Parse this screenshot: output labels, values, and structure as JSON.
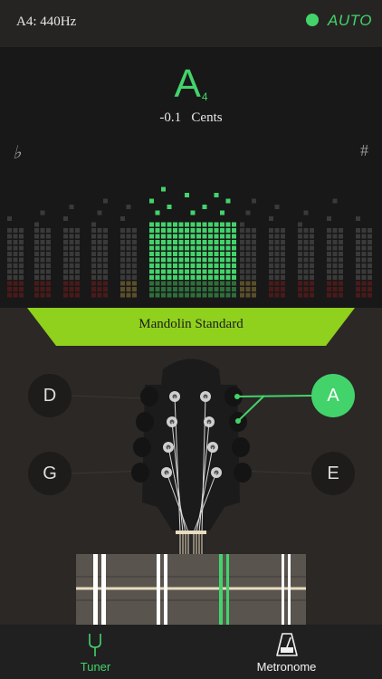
{
  "header": {
    "reference_pitch": "A4: 440Hz",
    "auto_label": "AUTO",
    "auto_color": "#43d36b"
  },
  "tuner": {
    "note": "A",
    "octave": "4",
    "cents_value": "-0.1",
    "cents_label": "Cents",
    "flat_symbol": "♭",
    "sharp_symbol": "#"
  },
  "tuning": {
    "name": "Mandolin Standard"
  },
  "strings": {
    "d": "D",
    "g": "G",
    "a": "A",
    "e": "E",
    "selected": "A"
  },
  "nav": {
    "tuner_label": "Tuner",
    "metronome_label": "Metronome",
    "active": "Tuner"
  },
  "colors": {
    "accent": "#43d36b",
    "band": "#8fd11c"
  }
}
